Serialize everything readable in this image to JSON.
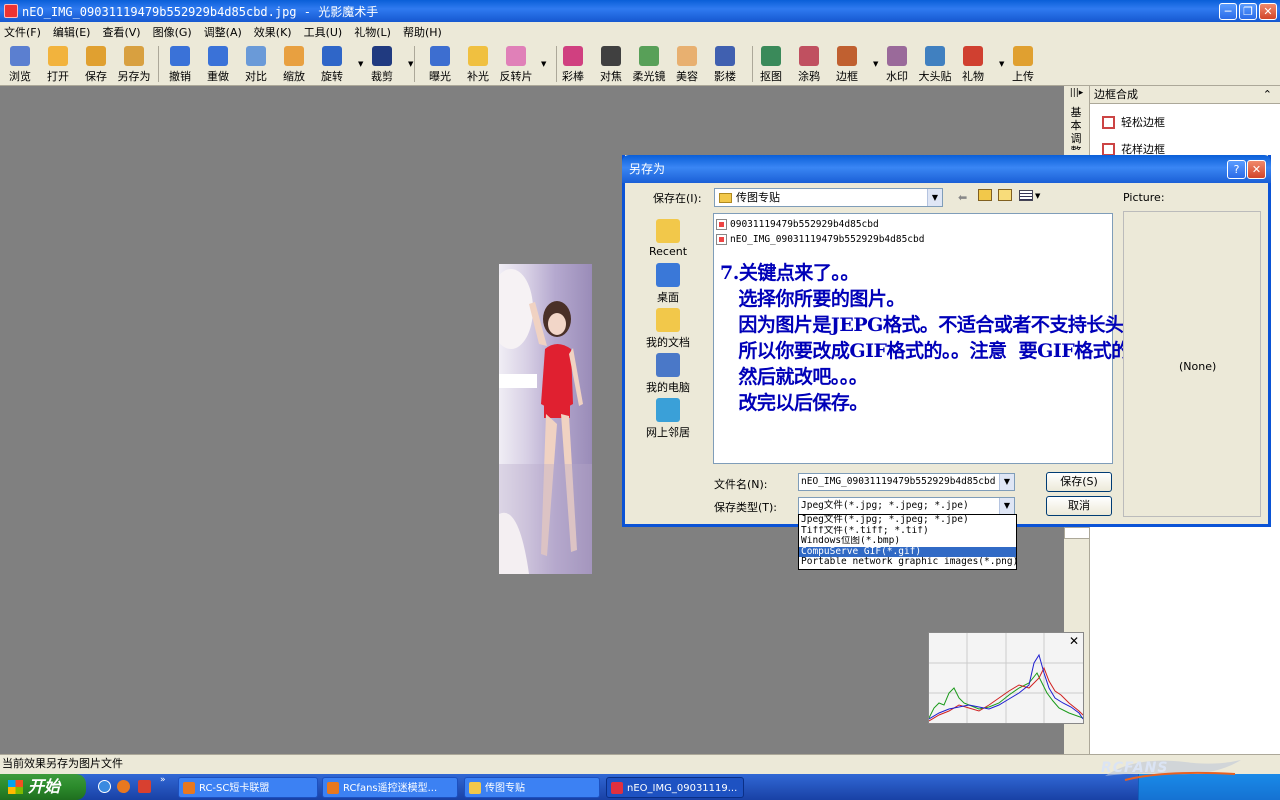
{
  "window": {
    "title": "nEO_IMG_09031119479b552929b4d85cbd.jpg - 光影魔术手"
  },
  "menu": [
    "文件(F)",
    "编辑(E)",
    "查看(V)",
    "图像(G)",
    "调整(A)",
    "效果(K)",
    "工具(U)",
    "礼物(L)",
    "帮助(H)"
  ],
  "toolbar": [
    {
      "label": "浏览",
      "icon": "eye-icon",
      "color": "#5b7fd0"
    },
    {
      "label": "打开",
      "icon": "folder-icon",
      "color": "#f2b33d"
    },
    {
      "label": "保存",
      "icon": "save-icon",
      "color": "#e0a030"
    },
    {
      "label": "另存为",
      "icon": "save-as-icon",
      "color": "#d8a040"
    },
    {
      "label": "撤销",
      "icon": "undo-icon",
      "color": "#3a72d8"
    },
    {
      "label": "重做",
      "icon": "redo-icon",
      "color": "#3a72d8"
    },
    {
      "label": "对比",
      "icon": "compare-icon",
      "color": "#6a9ad8"
    },
    {
      "label": "缩放",
      "icon": "resize-icon",
      "color": "#e8a040"
    },
    {
      "label": "旋转",
      "icon": "rotate-icon",
      "color": "#2f66c8"
    },
    {
      "label": "裁剪",
      "icon": "crop-icon",
      "color": "#203a80"
    },
    {
      "label": "曝光",
      "icon": "exposure-icon",
      "color": "#3d6ed0"
    },
    {
      "label": "补光",
      "icon": "fill-light-icon",
      "color": "#f0c040"
    },
    {
      "label": "反转片",
      "icon": "reversal-film-icon",
      "color": "#e080b8"
    },
    {
      "label": "彩棒",
      "icon": "color-wand-icon",
      "color": "#d04080"
    },
    {
      "label": "对焦",
      "icon": "focus-icon",
      "color": "#404040"
    },
    {
      "label": "柔光镜",
      "icon": "soft-light-icon",
      "color": "#58a058"
    },
    {
      "label": "美容",
      "icon": "beauty-icon",
      "color": "#e8b070"
    },
    {
      "label": "影楼",
      "icon": "studio-icon",
      "color": "#4060b0"
    },
    {
      "label": "抠图",
      "icon": "cutout-icon",
      "color": "#3a8a5a"
    },
    {
      "label": "涂鸦",
      "icon": "doodle-icon",
      "color": "#c05060"
    },
    {
      "label": "边框",
      "icon": "frame-icon",
      "color": "#c06030"
    },
    {
      "label": "水印",
      "icon": "watermark-icon",
      "color": "#9a6a9a"
    },
    {
      "label": "大头贴",
      "icon": "photo-sticker-icon",
      "color": "#4080c0"
    },
    {
      "label": "礼物",
      "icon": "gift-icon",
      "color": "#d04030"
    },
    {
      "label": "上传",
      "icon": "upload-icon",
      "color": "#e0a030"
    }
  ],
  "right_panel": {
    "title": "边框合成",
    "side_tab": "基本调整",
    "items": [
      "轻松边框",
      "花样边框"
    ]
  },
  "dialog": {
    "title": "另存为",
    "save_in_label": "保存在(I):",
    "save_in_value": "传图专贴",
    "places": [
      {
        "label": "Recent",
        "icon": "recent-icon",
        "color": "#f2c84a"
      },
      {
        "label": "桌面",
        "icon": "desktop-icon",
        "color": "#3a78d8"
      },
      {
        "label": "我的文档",
        "icon": "my-documents-icon",
        "color": "#f2c84a"
      },
      {
        "label": "我的电脑",
        "icon": "my-computer-icon",
        "color": "#4a78c8"
      },
      {
        "label": "网上邻居",
        "icon": "network-icon",
        "color": "#3aa0d8"
      }
    ],
    "files": [
      "09031119479b552929b4d85cbd",
      "nEO_IMG_09031119479b552929b4d85cbd"
    ],
    "annotation": [
      "7.关键点来了。。",
      "   选择你所要的图片。",
      "   因为图片是JEPG格式。不适合或者不支持长头像",
      "   所以你要改成GIF格式的。。注意  要GIF格式的!",
      "   然后就改吧。。。",
      "   改完以后保存。"
    ],
    "filename_label": "文件名(N):",
    "filename_value": "nEO_IMG_09031119479b552929b4d85cbd",
    "filetype_label": "保存类型(T):",
    "filetype_value": "Jpeg文件(*.jpg; *.jpeg; *.jpe)",
    "save_button": "保存(S)",
    "cancel_button": "取消",
    "preview_label": "Picture:",
    "preview_value": "(None)",
    "filetype_options": [
      "Jpeg文件(*.jpg; *.jpeg; *.jpe)",
      "Tiff文件(*.tiff; *.tif)",
      "Windows位图(*.bmp)",
      "CompuServe GIF(*.gif)",
      "Portable network graphic images(*.png)"
    ],
    "selected_option_index": 3
  },
  "status_bar": "当前效果另存为图片文件",
  "taskbar": {
    "start": "开始",
    "tasks": [
      "RC-SC短卡联盟",
      "RCfans遥控迷模型...",
      "传图专贴",
      "nEO_IMG_09031119..."
    ],
    "logo": "RCFANS"
  }
}
